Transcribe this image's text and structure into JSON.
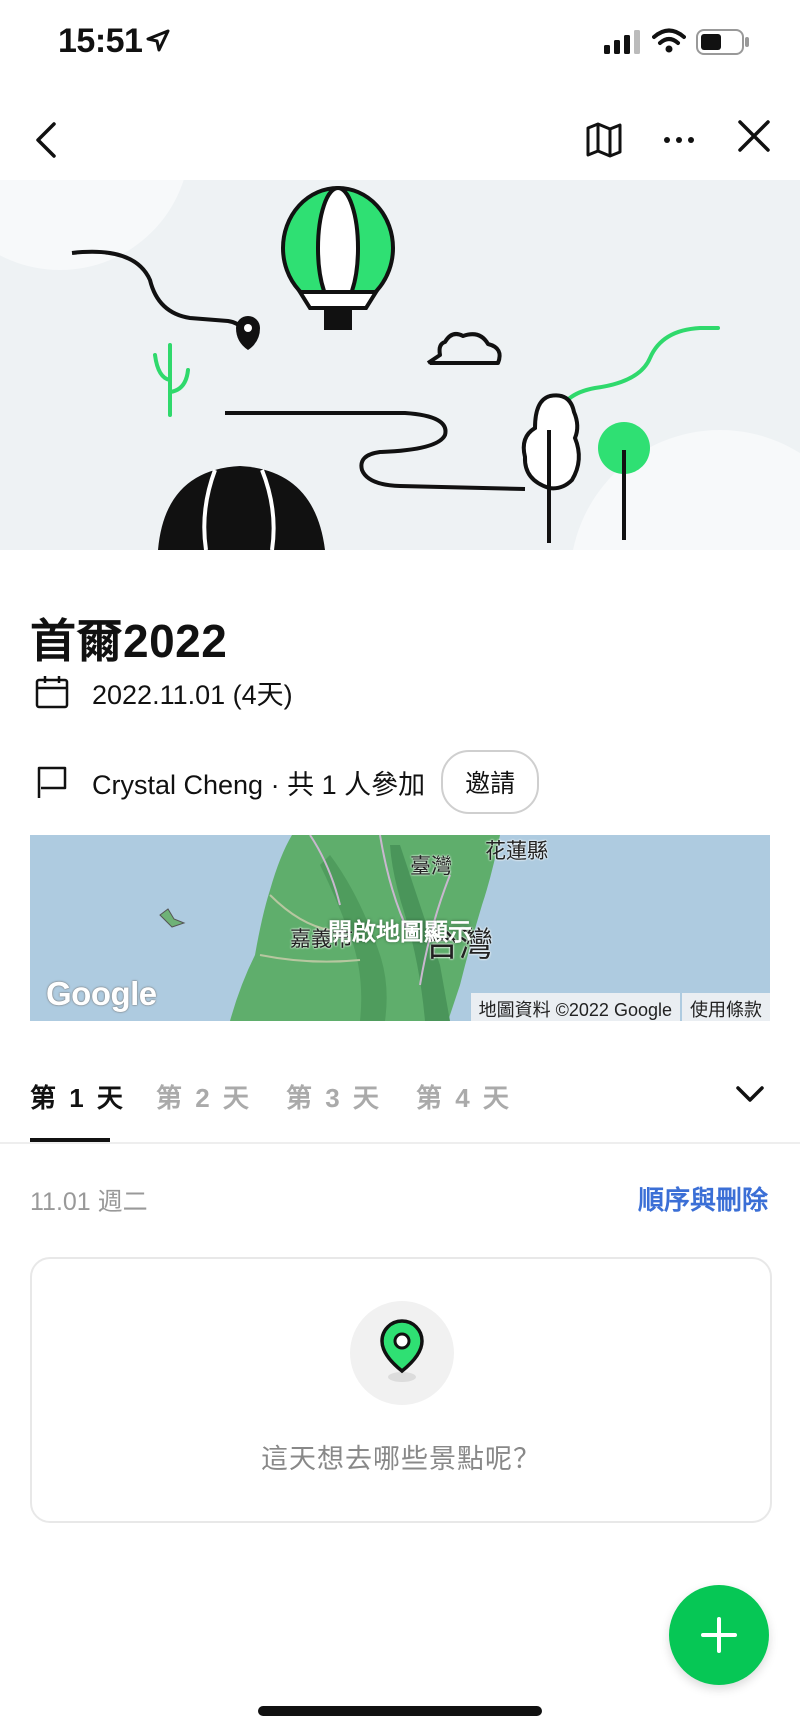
{
  "status_bar": {
    "time": "15:51"
  },
  "trip": {
    "title": "首爾2022",
    "date": "2022.11.01 (4天)",
    "owner_line": "Crystal Cheng · 共 1 人參加",
    "invite_label": "邀請"
  },
  "map": {
    "open_label": "開啟地圖顯示",
    "labels": {
      "hualien": "花蓮縣",
      "taiwan_small": "臺灣",
      "chiayi": "嘉義市",
      "taiwan_big": "台灣"
    },
    "logo": "Google",
    "attribution": "地圖資料 ©2022 Google",
    "terms": "使用條款"
  },
  "tabs": [
    {
      "label": "第 1 天",
      "active": true
    },
    {
      "label": "第 2 天",
      "active": false
    },
    {
      "label": "第 3 天",
      "active": false
    },
    {
      "label": "第 4 天",
      "active": false
    }
  ],
  "day": {
    "date_label": "11.01 週二",
    "reorder_label": "順序與刪除",
    "empty_prompt": "這天想去哪些景點呢？"
  },
  "colors": {
    "accent_green": "#06c755",
    "link_blue": "#3b6fd6",
    "hero_bg": "#eef2f4"
  }
}
